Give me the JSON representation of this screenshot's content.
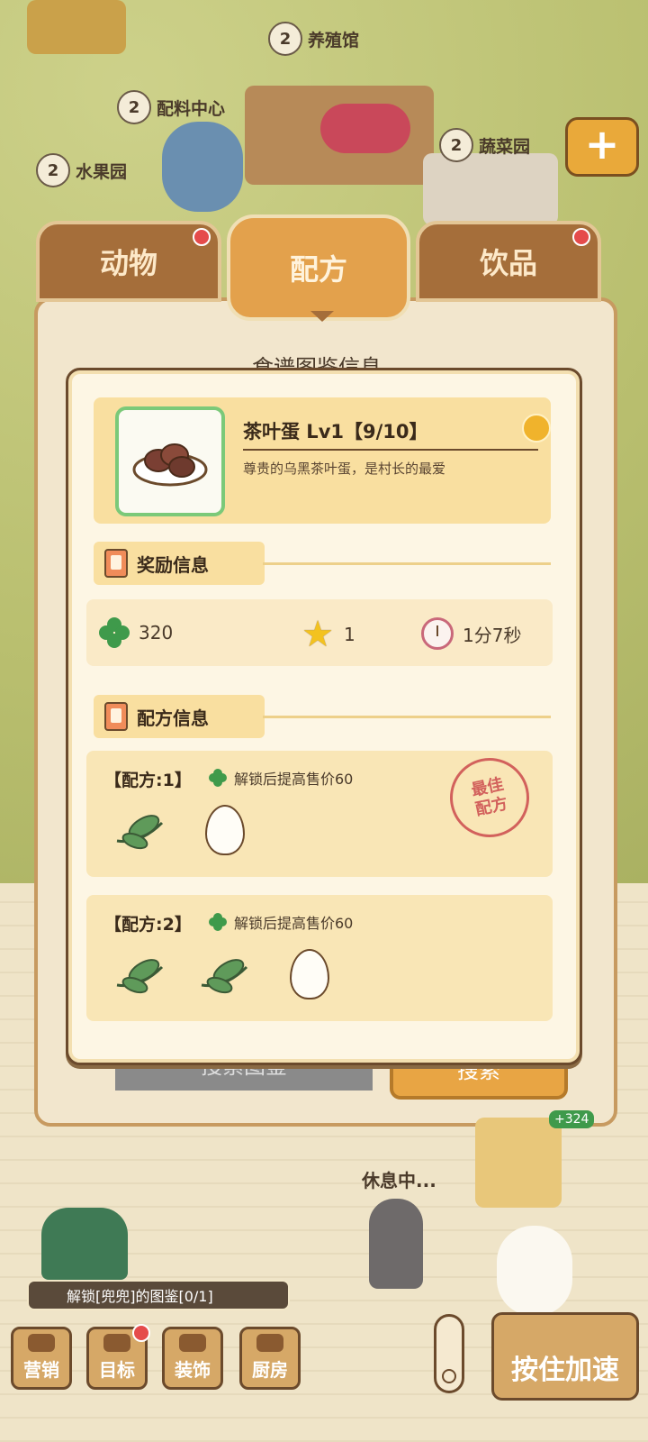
{
  "buildings": [
    {
      "id": "breeding",
      "num": "2",
      "label": "养殖馆"
    },
    {
      "id": "ingredients",
      "num": "2",
      "label": "配料中心"
    },
    {
      "id": "vegetables",
      "num": "2",
      "label": "蔬菜园"
    },
    {
      "id": "fruit",
      "num": "2",
      "label": "水果园"
    }
  ],
  "tabs": [
    {
      "label": "动物",
      "active": false,
      "badge": true
    },
    {
      "label": "配方",
      "active": true,
      "badge": false
    },
    {
      "label": "饮品",
      "active": false,
      "badge": true
    }
  ],
  "back_panel": {
    "title": "食谱图鉴信息",
    "search_label": "搜索图鉴",
    "search_button": "搜索"
  },
  "detail": {
    "item_name": "茶叶蛋 Lv1【9/10】",
    "item_desc": "尊贵的乌黑茶叶蛋，是村长的最爱",
    "reward_section": "奖励信息",
    "rewards": {
      "clover": "320",
      "star": "1",
      "time": "1分7秒"
    },
    "recipe_section": "配方信息",
    "recipes": [
      {
        "title": "【配方:1】",
        "unlock": "解锁后提高售价60",
        "ingredients": [
          "tea-leaf",
          "egg"
        ],
        "best": true,
        "stamp_line1": "最佳",
        "stamp_line2": "配方"
      },
      {
        "title": "【配方:2】",
        "unlock": "解锁后提高售价60",
        "ingredients": [
          "tea-leaf",
          "tea-leaf",
          "egg"
        ],
        "best": false
      }
    ]
  },
  "scene": {
    "rest_text": "休息中...",
    "unlock_tip": "解锁[兜兜]的图鉴[0/1]",
    "badge_value": "+324"
  },
  "bottom_bar": [
    {
      "label": "营销",
      "badge": false
    },
    {
      "label": "目标",
      "badge": true
    },
    {
      "label": "装饰",
      "badge": false
    },
    {
      "label": "厨房",
      "badge": false
    }
  ],
  "speed_button": "按住加速",
  "colors": {
    "accent": "#e3a14c",
    "panel": "#fdf6e4",
    "clover": "#3f9a4b",
    "stamp": "#d2615c"
  }
}
